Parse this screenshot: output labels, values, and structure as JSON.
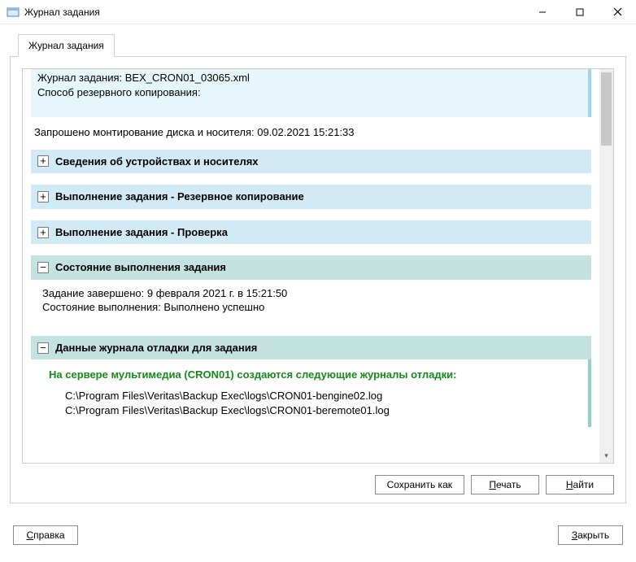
{
  "window": {
    "title": "Журнал задания"
  },
  "tab": {
    "label": "Журнал задания"
  },
  "top_block": {
    "line1": "Журнал задания: BEX_CRON01_03065.xml",
    "line2": "Способ резервного копирования:"
  },
  "mount_request": "Запрошено монтирование диска и носителя: 09.02.2021 15:21:33",
  "sections": {
    "devices": {
      "title": "Сведения об устройствах и носителях",
      "expanded": false
    },
    "backup": {
      "title": "Выполнение задания - Резервное копирование",
      "expanded": false
    },
    "verify": {
      "title": "Выполнение задания - Проверка",
      "expanded": false
    },
    "status": {
      "title": "Состояние выполнения задания",
      "expanded": true,
      "lines": {
        "finished": "Задание завершено: 9 февраля 2021 г. в 15:21:50",
        "state": "Состояние выполнения: Выполнено успешно"
      }
    },
    "debug": {
      "title": "Данные журнала отладки для задания",
      "expanded": true,
      "green": "На сервере мультимедиа  (CRON01) создаются следующие журналы отладки:",
      "paths": {
        "p1": "C:\\Program Files\\Veritas\\Backup Exec\\logs\\CRON01-bengine02.log",
        "p2": "C:\\Program Files\\Veritas\\Backup Exec\\logs\\CRON01-beremote01.log"
      }
    }
  },
  "buttons": {
    "save_as": "Сохранить как",
    "print": "Печать",
    "find": "Найти",
    "help": "Справка",
    "close": "Закрыть"
  },
  "accel": {
    "print_letter": "П",
    "find_letter": "Н",
    "help_letter": "С",
    "close_letter": "З"
  }
}
